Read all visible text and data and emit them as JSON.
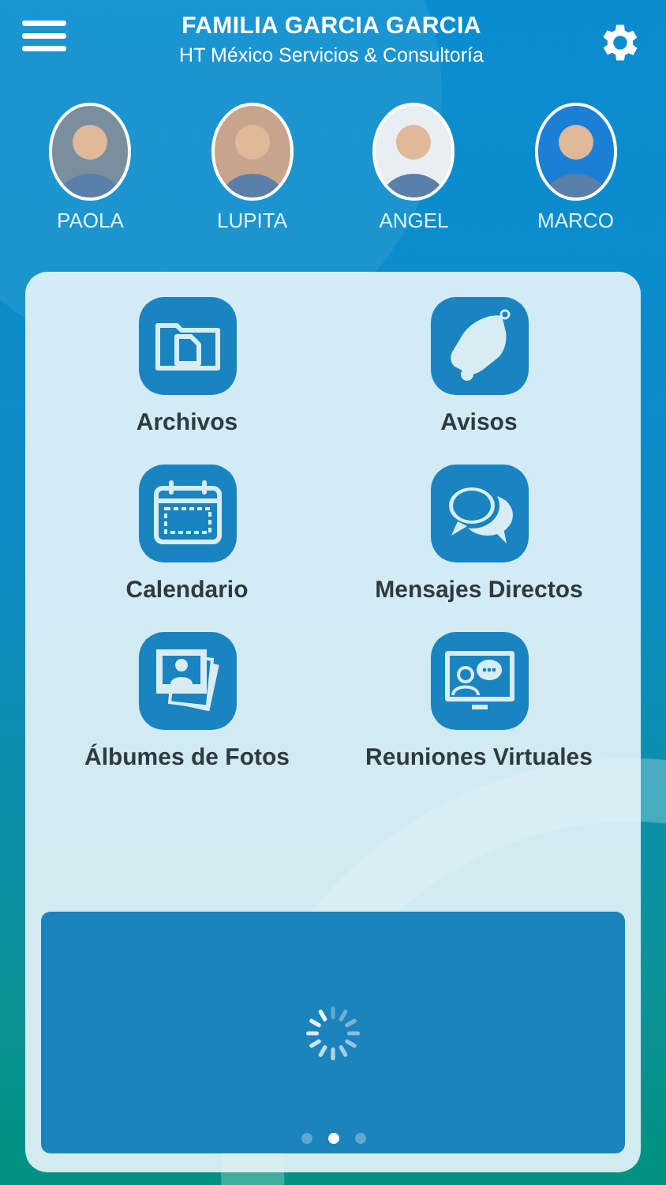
{
  "header": {
    "title": "FAMILIA GARCIA GARCIA",
    "subtitle": "HT México Servicios & Consultoría"
  },
  "members": [
    {
      "name": "PAOLA",
      "kind": "picture"
    },
    {
      "name": "LUPITA",
      "kind": "picture"
    },
    {
      "name": "ANGEL",
      "kind": "picture"
    },
    {
      "name": "MARCO",
      "kind": "picture"
    }
  ],
  "tiles": [
    {
      "label": "Archivos"
    },
    {
      "label": "Avisos"
    },
    {
      "label": "Calendario"
    },
    {
      "label": "Mensajes Directos"
    },
    {
      "label": "Álbumes de Fotos"
    },
    {
      "label": "Reuniones Virtuales"
    }
  ],
  "carousel": {
    "pages": [
      {
        "selected": false
      },
      {
        "selected": true
      },
      {
        "selected": false
      }
    ]
  }
}
